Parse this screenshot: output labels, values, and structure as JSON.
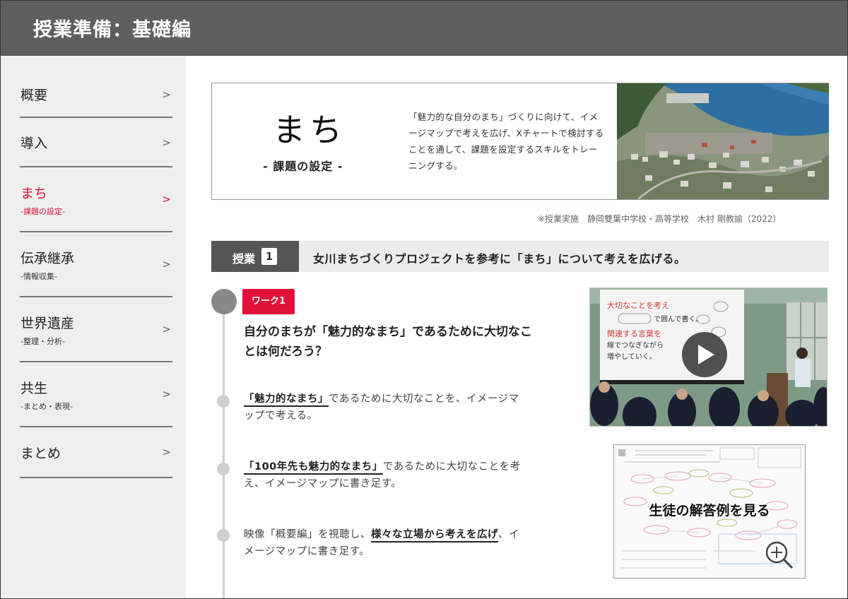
{
  "header": {
    "title": "授業準備：基礎編"
  },
  "sidebar": {
    "chevron": ">",
    "items": [
      {
        "label": "概要",
        "sub": ""
      },
      {
        "label": "導入",
        "sub": ""
      },
      {
        "label": "まち",
        "sub": "-課題の設定-"
      },
      {
        "label": "伝承継承",
        "sub": "-情報収集-"
      },
      {
        "label": "世界遺産",
        "sub": "-整理・分析-"
      },
      {
        "label": "共生",
        "sub": "-まとめ・表現-"
      },
      {
        "label": "まとめ",
        "sub": ""
      }
    ]
  },
  "hero": {
    "title": "まち",
    "subtitle": "- 課題の設定 -",
    "description": "「魅力的な自分のまち」づくりに向けて、イメージマップで考えを広げ、Xチャートで検討することを通して、課題を設定するスキルをトレーニングする。"
  },
  "credit": "※授業実施　静岡雙葉中学校・高等学校　木村 剛教諭（2022）",
  "lesson": {
    "badge_label": "授業",
    "number": "1",
    "title": "女川まちづくりプロジェクトを参考に「まち」について考えを広げる。"
  },
  "work": {
    "badge": "ワーク1",
    "question": "自分のまちが「魅力的なまち」であるために大切なことは何だろう？",
    "steps": [
      {
        "pre": "",
        "em": "「魅力的なまち」",
        "post": "であるために大切なことを、イメージマップで考える。"
      },
      {
        "pre": "",
        "em": "「100年先も魅力的なまち」",
        "post": "であるために大切なことを考え、イメージマップに書き足す。"
      },
      {
        "pre": "映像「概要編」を視聴し、",
        "em": "様々な立場から考えを広げ",
        "post": "、イメージマップに書き足す。"
      }
    ]
  },
  "video": {
    "slide_line1": "大切なことを考え",
    "slide_line2": "で囲んで書く。",
    "slide_line3": "関連する言葉を",
    "slide_line4": "線でつなぎながら",
    "slide_line5": "増やしていく。"
  },
  "answer": {
    "label": "生徒の解答例を見る"
  },
  "colors": {
    "accent": "#e0103a",
    "header_bg": "#5f5f5f",
    "sidebar_bg": "#efefef"
  }
}
